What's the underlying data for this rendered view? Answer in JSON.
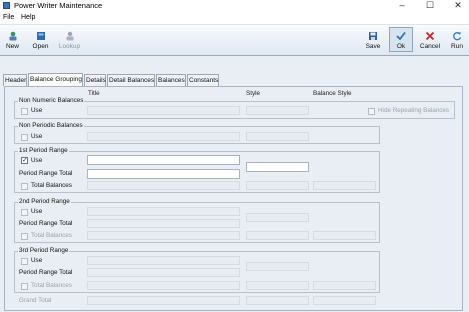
{
  "window": {
    "title": "Power Writer Maintenance"
  },
  "menu": {
    "file": "File",
    "help": "Help"
  },
  "toolbar": {
    "new": "New",
    "open": "Open",
    "lookup": "Lookup",
    "save": "Save",
    "ok": "Ok",
    "cancel": "Cancel",
    "run": "Run"
  },
  "tabs": [
    "Header",
    "Balance Grouping",
    "Details",
    "Detail Balances",
    "Balances",
    "Constants"
  ],
  "columns": {
    "title": "Title",
    "style": "Style",
    "balance_style": "Balance Style"
  },
  "groups": {
    "non_numeric": {
      "label": "Non Numeric Balances",
      "use": "Use",
      "hide_repeating": "Hide Repeating Balances"
    },
    "non_periodic": {
      "label": "Non Periodic Balances",
      "use": "Use"
    },
    "period1": {
      "label": "1st Period Range",
      "use": "Use",
      "range_total": "Period Range Total",
      "total_balances": "Total Balances"
    },
    "period2": {
      "label": "2nd Period Range",
      "use": "Use",
      "range_total": "Period Range Total",
      "total_balances": "Total Balances"
    },
    "period3": {
      "label": "3rd Period Range",
      "use": "Use",
      "range_total": "Period Range Total",
      "total_balances": "Total Balances"
    }
  },
  "grand_total": "Grand Total"
}
